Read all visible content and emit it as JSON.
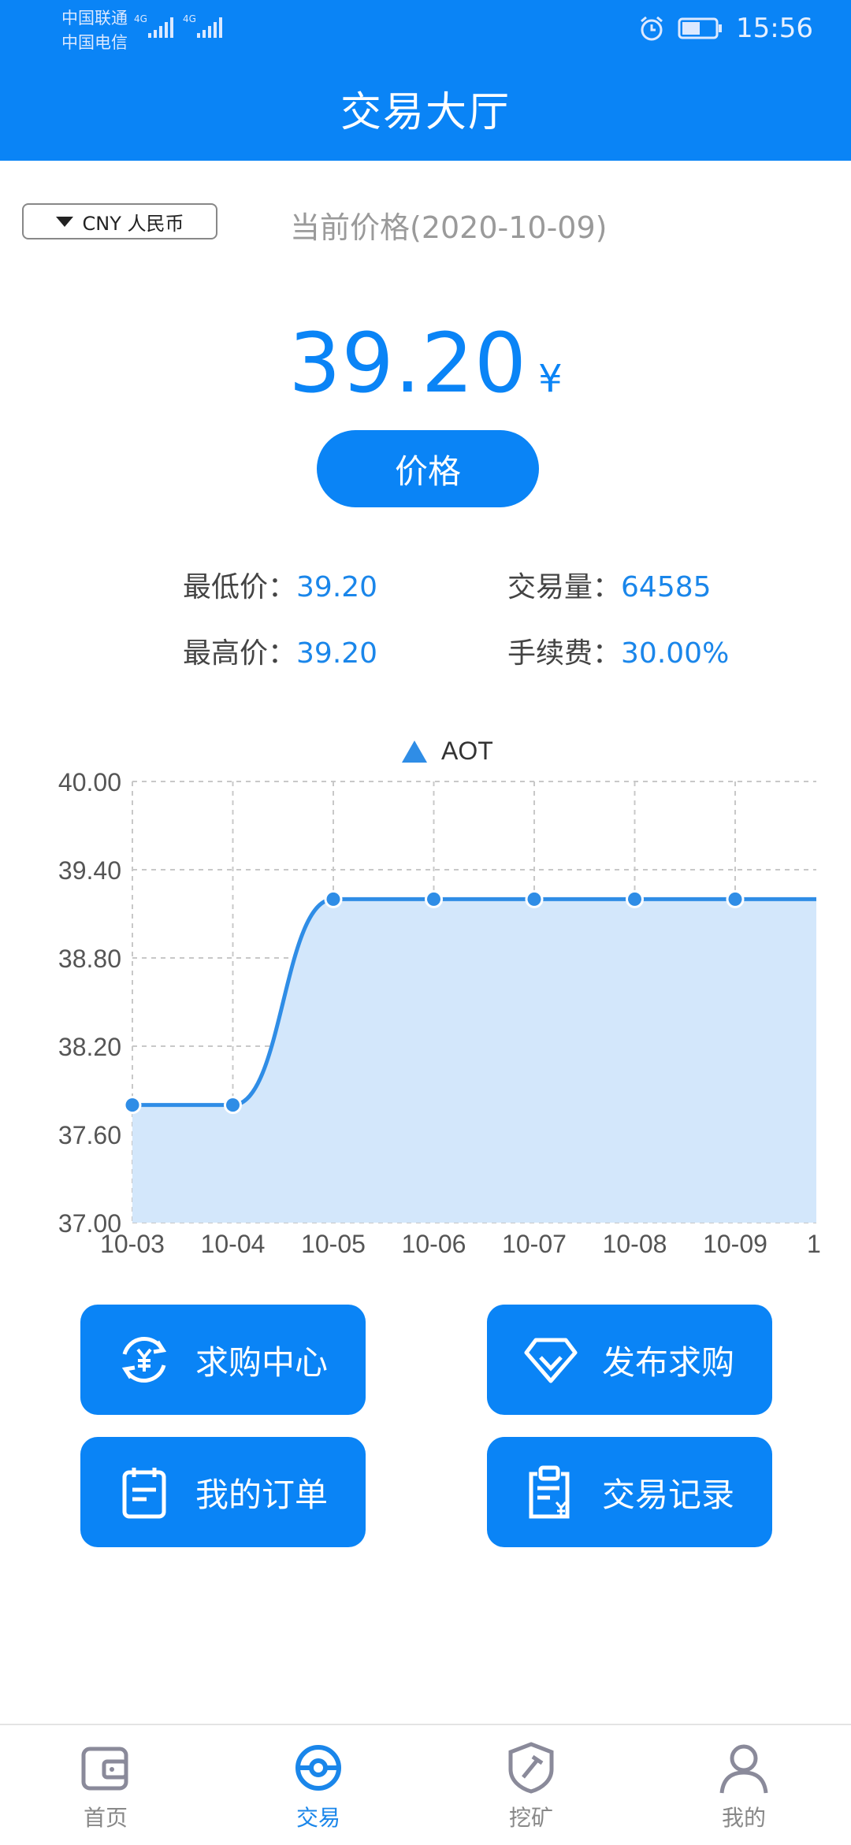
{
  "status_bar": {
    "carrier1": "中国联通",
    "carrier2": "中国电信",
    "network1": "4G",
    "network2": "4G",
    "time": "15:56"
  },
  "header": {
    "title": "交易大厅"
  },
  "currency": {
    "selected": "CNY 人民币"
  },
  "price_section": {
    "date_label": "当前价格(2020-10-09)",
    "price": "39.20",
    "currency_symbol": "¥",
    "button_label": "价格"
  },
  "stats": {
    "min_label": "最低价：",
    "min_value": "39.20",
    "max_label": "最高价：",
    "max_value": "39.20",
    "volume_label": "交易量：",
    "volume_value": "64585",
    "fee_label": "手续费：",
    "fee_value": "30.00%"
  },
  "chart_data": {
    "type": "area",
    "legend": "AOT",
    "legend_position": "top-center",
    "grid": true,
    "x": [
      "10-03",
      "10-04",
      "10-05",
      "10-06",
      "10-07",
      "10-08",
      "10-09",
      "1"
    ],
    "values": [
      37.8,
      37.8,
      39.2,
      39.2,
      39.2,
      39.2,
      39.2,
      39.2
    ],
    "ylim": [
      37.0,
      40.0
    ],
    "yticks": [
      "37.00",
      "37.60",
      "38.20",
      "38.80",
      "39.40",
      "40.00"
    ],
    "series_color": "#2f8de6",
    "fill_color": "#d3e7fb"
  },
  "actions": {
    "buy_center": "求购中心",
    "publish_buy": "发布求购",
    "my_orders": "我的订单",
    "trade_records": "交易记录"
  },
  "bottom_nav": {
    "home": "首页",
    "trade": "交易",
    "mining": "挖矿",
    "mine": "我的"
  },
  "colors": {
    "primary": "#0a84f6",
    "value_text": "#1a86ea"
  }
}
